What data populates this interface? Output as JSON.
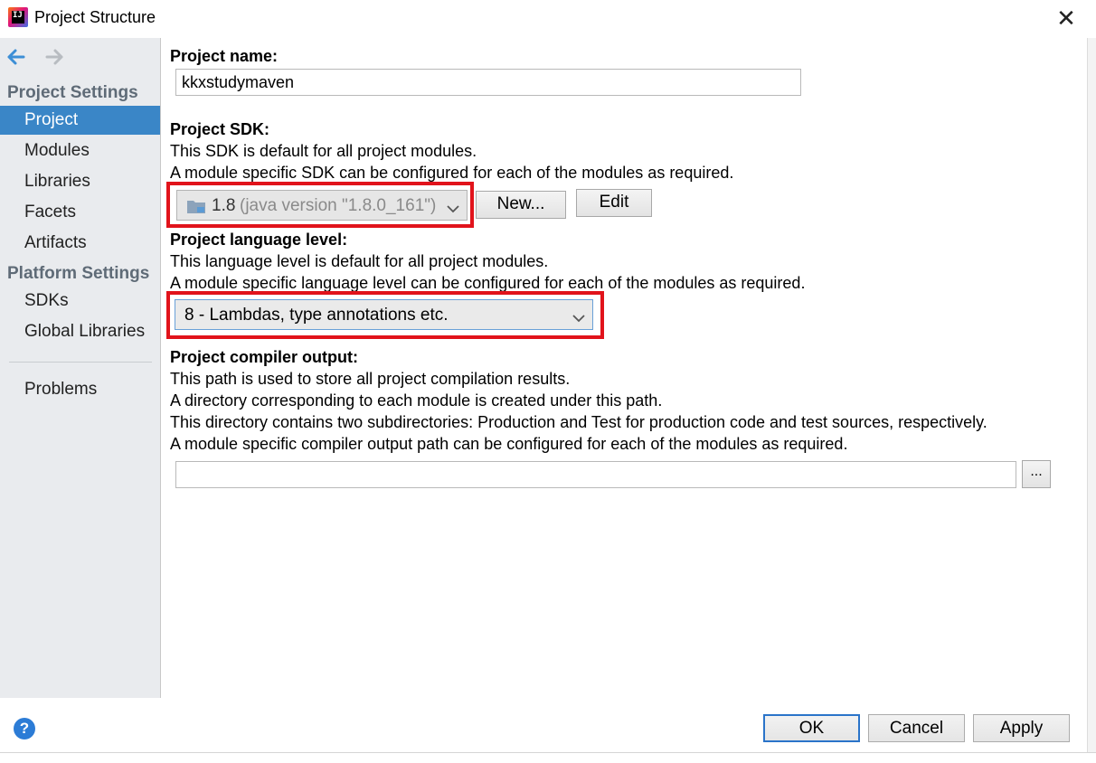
{
  "window": {
    "title": "Project Structure",
    "logo_text": "IJ"
  },
  "sidebar": {
    "project_settings_header": "Project Settings",
    "platform_settings_header": "Platform Settings",
    "items": [
      {
        "label": "Project",
        "selected": true
      },
      {
        "label": "Modules"
      },
      {
        "label": "Libraries"
      },
      {
        "label": "Facets"
      },
      {
        "label": "Artifacts"
      },
      {
        "label": "SDKs"
      },
      {
        "label": "Global Libraries"
      },
      {
        "label": "Problems"
      }
    ]
  },
  "project_name": {
    "label": "Project name:",
    "value": "kkxstudymaven"
  },
  "project_sdk": {
    "label": "Project SDK:",
    "desc1": "This SDK is default for all project modules.",
    "desc2": "A module specific SDK can be configured for each of the modules as required.",
    "selected_version": "1.8",
    "selected_detail": "(java version \"1.8.0_161\")",
    "new_button": "New...",
    "edit_button": "Edit"
  },
  "language_level": {
    "label": "Project language level:",
    "desc1": "This language level is default for all project modules.",
    "desc2": "A module specific language level can be configured for each of the modules as required.",
    "selected": "8 - Lambdas, type annotations etc."
  },
  "compiler_output": {
    "label": "Project compiler output:",
    "desc1": "This path is used to store all project compilation results.",
    "desc2": "A directory corresponding to each module is created under this path.",
    "desc3": "This directory contains two subdirectories: Production and Test for production code and test sources, respectively.",
    "desc4": "A module specific compiler output path can be configured for each of the modules as required.",
    "path_value": "",
    "browse_button": "..."
  },
  "footer": {
    "help": "?",
    "ok": "OK",
    "cancel": "Cancel",
    "apply": "Apply"
  },
  "colors": {
    "selection": "#3a86c7",
    "highlight_box": "#e1131b",
    "default_button_border": "#2a74c9"
  }
}
